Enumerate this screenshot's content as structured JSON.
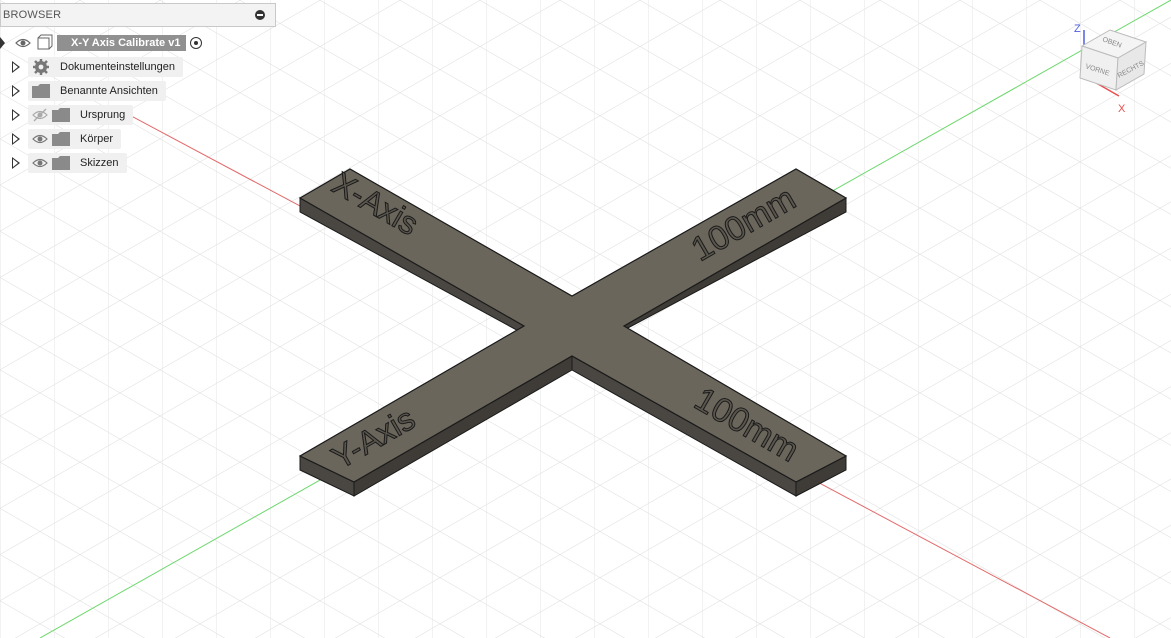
{
  "browser": {
    "title": "BROWSER",
    "root": {
      "label": "X-Y Axis Calibrate v1"
    },
    "items": [
      {
        "label": "Dokumenteinstellungen",
        "icon": "gear-icon"
      },
      {
        "label": "Benannte Ansichten",
        "icon": "folder-icon"
      },
      {
        "label": "Ursprung",
        "icon": "folder-icon",
        "visibility": "hidden"
      },
      {
        "label": "Körper",
        "icon": "folder-icon",
        "visibility": "visible"
      },
      {
        "label": "Skizzen",
        "icon": "folder-icon",
        "visibility": "visible"
      }
    ]
  },
  "model": {
    "label_x_axis": "X-Axis",
    "label_y_axis": "Y-Axis",
    "label_top_right": "100mm",
    "label_bottom_right": "100mm"
  },
  "viewcube": {
    "face_top": "OBEN",
    "face_front": "VORNE",
    "face_right": "RECHTS",
    "axis_z": "Z",
    "axis_x": "X",
    "colors": {
      "x": "#e55050",
      "y": "#48c048",
      "z": "#5060e0"
    }
  }
}
